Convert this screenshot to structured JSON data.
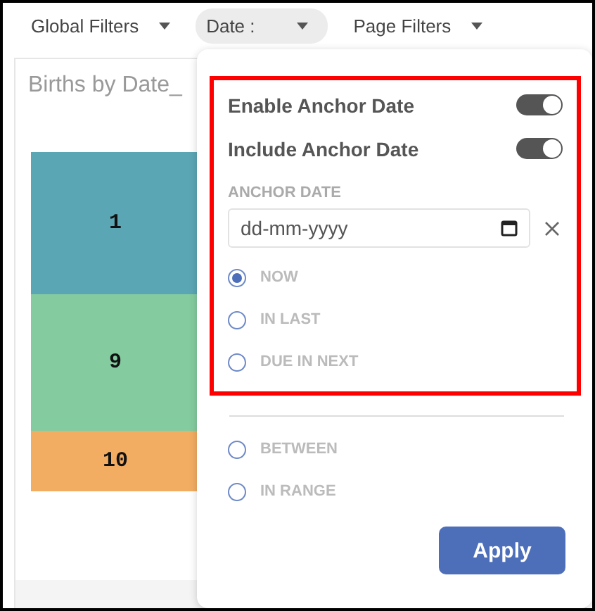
{
  "filter_bar": [
    {
      "label": "Global Filters",
      "selected": false
    },
    {
      "label": "Date :",
      "selected": true
    },
    {
      "label": "Page Filters",
      "selected": false
    }
  ],
  "chart": {
    "title": "Births by Date_",
    "tiles": [
      {
        "label": "1",
        "color": "#5ba6b5"
      },
      {
        "label": "9",
        "color": "#84cba0"
      },
      {
        "label": "10",
        "color": "#f2ad62"
      }
    ]
  },
  "date_popover": {
    "toggles": [
      {
        "label": "Enable Anchor Date",
        "on": true
      },
      {
        "label": "Include Anchor Date",
        "on": true
      }
    ],
    "anchor_date": {
      "label": "ANCHOR DATE",
      "placeholder": "dd-mm-yyyy"
    },
    "options": [
      {
        "label": "NOW",
        "selected": true
      },
      {
        "label": "IN LAST",
        "selected": false
      },
      {
        "label": "DUE IN NEXT",
        "selected": false
      }
    ],
    "more_options": [
      {
        "label": "BETWEEN",
        "selected": false
      },
      {
        "label": "IN RANGE",
        "selected": false
      }
    ],
    "apply_button": "Apply"
  }
}
